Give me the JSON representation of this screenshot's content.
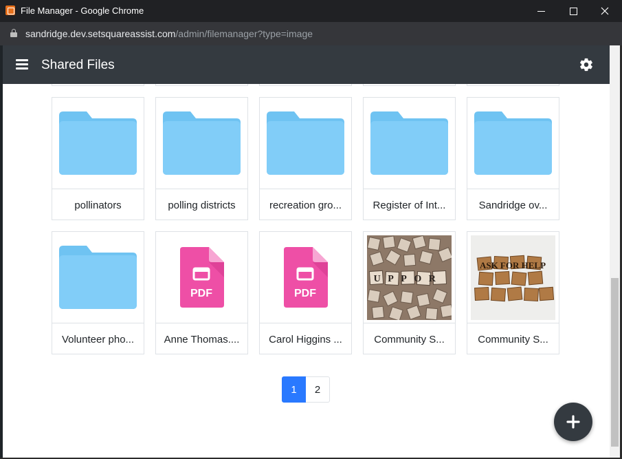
{
  "window": {
    "title": "File Manager - Google Chrome",
    "url_host": "sandridge.dev.setsquareassist.com",
    "url_path": "/admin/filemanager?type=image"
  },
  "appbar": {
    "title": "Shared Files"
  },
  "files": [
    {
      "name": "pollinators",
      "kind": "folder"
    },
    {
      "name": "polling districts",
      "kind": "folder"
    },
    {
      "name": "recreation gro...",
      "kind": "folder"
    },
    {
      "name": "Register of Int...",
      "kind": "folder"
    },
    {
      "name": "Sandridge ov...",
      "kind": "folder"
    },
    {
      "name": "Volunteer pho...",
      "kind": "folder"
    },
    {
      "name": "Anne Thomas....",
      "kind": "pdf",
      "badge": "PDF"
    },
    {
      "name": "Carol Higgins ...",
      "kind": "pdf",
      "badge": "PDF"
    },
    {
      "name": "Community S...",
      "kind": "image",
      "tiles": "UPPOR"
    },
    {
      "name": "Community S...",
      "kind": "image",
      "tiles": "ASK FOR HELP"
    }
  ],
  "pagination": {
    "pages": [
      "1",
      "2"
    ],
    "current": "1"
  },
  "colors": {
    "appbar": "#343a40",
    "folder": "#81cdf8",
    "pdf": "#ee4fa6",
    "page_active": "#2979ff"
  },
  "icons": {
    "menu": "menu-icon",
    "settings": "gear-icon",
    "add": "plus-icon"
  }
}
